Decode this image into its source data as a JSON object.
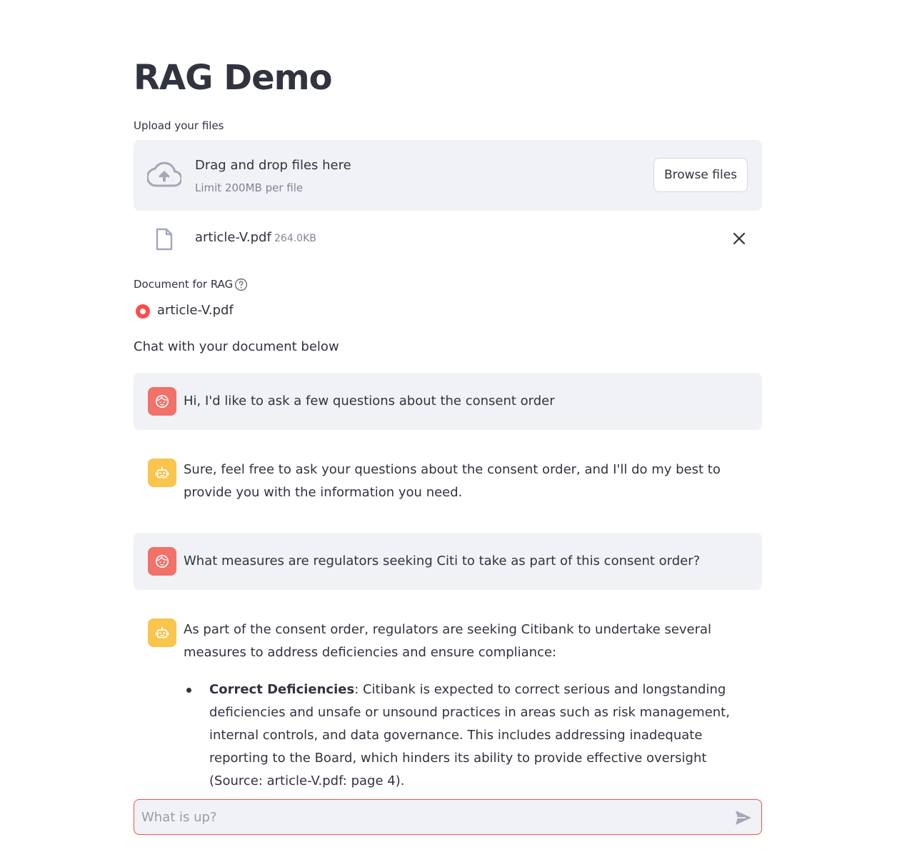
{
  "page": {
    "title": "RAG Demo"
  },
  "uploader": {
    "label": "Upload your files",
    "drop_title": "Drag and drop files here",
    "drop_subtitle": "Limit 200MB per file",
    "browse_label": "Browse files",
    "icon": "cloud-upload-icon"
  },
  "uploaded_file": {
    "name": "article-V.pdf",
    "size": "264.0KB",
    "icon": "file-icon"
  },
  "document_select": {
    "label": "Document for RAG",
    "options": [
      "article-V.pdf"
    ],
    "selected": "article-V.pdf",
    "accent_color": "#ff4b4b"
  },
  "chat": {
    "intro": "Chat with your document below",
    "messages": [
      {
        "role": "user",
        "text": "Hi, I'd like to ask a few questions about the consent order"
      },
      {
        "role": "assistant",
        "text": "Sure, feel free to ask your questions about the consent order, and I'll do my best to provide you with the information you need."
      },
      {
        "role": "user",
        "text": "What measures are regulators seeking Citi to take as part of this consent order?"
      },
      {
        "role": "assistant",
        "text": "As part of the consent order, regulators are seeking Citibank to undertake several measures to address deficiencies and ensure compliance:",
        "bullets": [
          {
            "bold": "Correct Deficiencies",
            "text": ": Citibank is expected to correct serious and longstanding deficiencies and unsafe or unsound practices in areas such as risk management, internal controls, and data governance. This includes addressing inadequate reporting to the Board, which hinders its ability to provide effective oversight (Source: article-V.pdf: page 4)."
          }
        ]
      }
    ],
    "input_placeholder": "What is up?",
    "user_avatar_color": "#f07268",
    "assistant_avatar_color": "#f9c54d"
  }
}
